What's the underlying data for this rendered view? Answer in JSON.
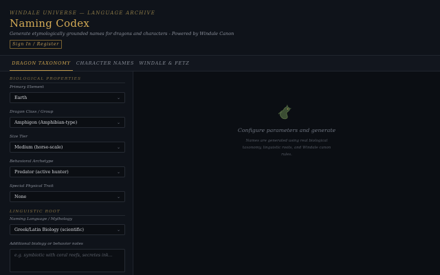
{
  "header": {
    "kicker": "WINDALE UNIVERSE — LANGUAGE ARCHIVE",
    "title": "Naming Codex",
    "subtitle": "Generate etymologically grounded names for dragons and characters - Powered by Windale Canon",
    "signin_label": "Sign In / Register"
  },
  "tabs": [
    {
      "label": "DRAGON TAXONOMY",
      "active": true
    },
    {
      "label": "CHARACTER NAMES",
      "active": false
    },
    {
      "label": "WINDALE & FETZ",
      "active": false
    }
  ],
  "form": {
    "section_bio": "BIOLOGICAL PROPERTIES",
    "fields": [
      {
        "label": "Primary Element",
        "value": "Earth"
      },
      {
        "label": "Dragon Class / Group",
        "value": "Amphigon (Amphibian-type)"
      },
      {
        "label": "Size Tier",
        "value": "Medium (horse-scale)"
      },
      {
        "label": "Behavioral Archetype",
        "value": "Predator (active hunter)"
      },
      {
        "label": "Special Physical Trait",
        "value": "None"
      }
    ],
    "section_ling": "LINGUISTIC ROOT",
    "language": {
      "label": "Naming Language / Mythology",
      "value": "Greek/Latin Biology (scientific)"
    },
    "notes": {
      "label": "Additional biology or behavior notes",
      "placeholder": "e.g. symbiotic with coral reefs, secretes ink..."
    }
  },
  "empty_state": {
    "icon": "dragon-icon",
    "title": "Configure parameters and generate",
    "text": "Names are generated using real biological taxonomy, linguistic roots, and Windale canon rules."
  },
  "colors": {
    "accent": "#d3aa55",
    "background": "#0d1016"
  }
}
